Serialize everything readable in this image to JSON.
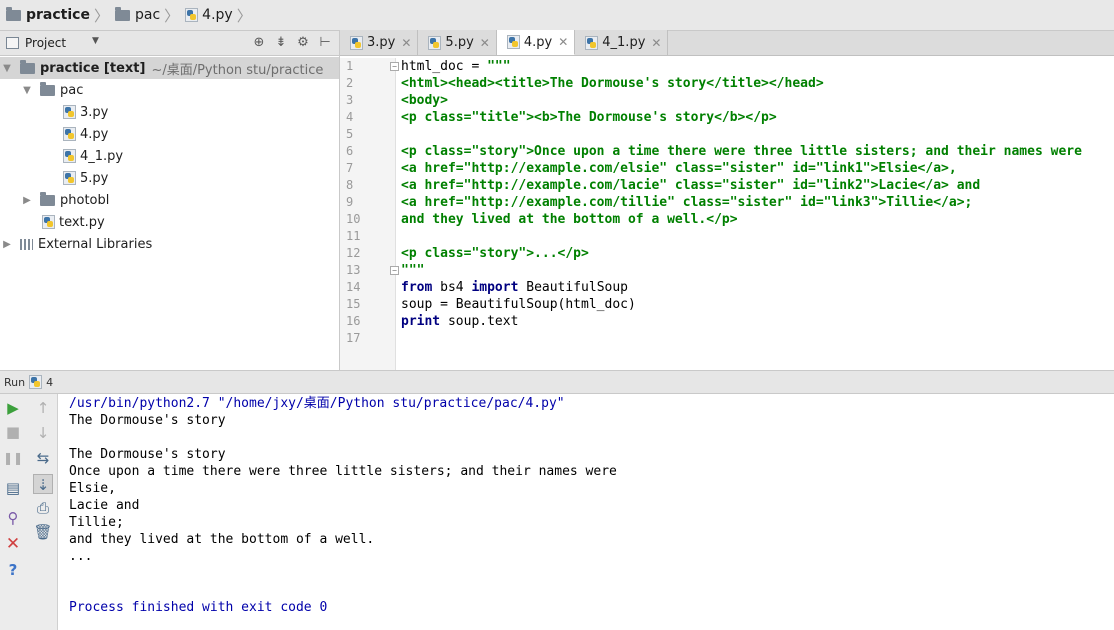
{
  "breadcrumb": {
    "root": "practice",
    "folder": "pac",
    "file": "4.py"
  },
  "project_panel": {
    "title": "Project",
    "tree": {
      "root_name": "practice [text]",
      "root_path": "~/桌面/Python stu/practice",
      "pac": "pac",
      "files": [
        "3.py",
        "4.py",
        "4_1.py",
        "5.py"
      ],
      "photobl": "photobl",
      "text_py": "text.py",
      "external": "External Libraries"
    }
  },
  "tabs": [
    "3.py",
    "5.py",
    "4.py",
    "4_1.py"
  ],
  "active_tab": "4.py",
  "editor": {
    "line_numbers": [
      "1",
      "2",
      "3",
      "4",
      "5",
      "6",
      "7",
      "8",
      "9",
      "10",
      "11",
      "12",
      "13",
      "14",
      "15",
      "16",
      "17"
    ],
    "lines": [
      "html_doc = \"\"\"",
      "<html><head><title>The Dormouse's story</title></head>",
      "<body>",
      "<p class=\"title\"><b>The Dormouse's story</b></p>",
      "",
      "<p class=\"story\">Once upon a time there were three little sisters; and their names were",
      "<a href=\"http://example.com/elsie\" class=\"sister\" id=\"link1\">Elsie</a>,",
      "<a href=\"http://example.com/lacie\" class=\"sister\" id=\"link2\">Lacie</a> and",
      "<a href=\"http://example.com/tillie\" class=\"sister\" id=\"link3\">Tillie</a>;",
      "and they lived at the bottom of a well.</p>",
      "",
      "<p class=\"story\">...</p>",
      "\"\"\"",
      "from bs4 import BeautifulSoup",
      "soup = BeautifulSoup(html_doc)",
      "print soup.text",
      ""
    ],
    "code_parts": {
      "var": "html_doc = ",
      "quote": "\"\"\"",
      "kw_from": "from",
      "mod": " bs4 ",
      "kw_import": "import",
      "cls": " BeautifulSoup",
      "kw_print": "print",
      "print_rest": " soup.text"
    }
  },
  "run": {
    "label": "Run",
    "config": "4",
    "command": "/usr/bin/python2.7 \"/home/jxy/桌面/Python stu/practice/pac/4.py\"",
    "output": [
      "The Dormouse's story",
      "",
      "The Dormouse's story",
      "Once upon a time there were three little sisters; and their names were",
      "Elsie,",
      "Lacie and",
      "Tillie;",
      "and they lived at the bottom of a well.",
      "...",
      "",
      ""
    ],
    "exit": "Process finished with exit code 0"
  },
  "colors": {
    "string": "#008000",
    "keyword": "#000080",
    "console_blue": "#0000aa",
    "run_green": "#3ca03c",
    "stop_red": "#d04040"
  },
  "icons": [
    "folder-icon",
    "python-file-icon",
    "project-icon",
    "locate-icon",
    "collapse-icon",
    "settings-icon",
    "hide-icon",
    "run-icon",
    "stop-icon",
    "pause-icon",
    "up-icon",
    "down-icon",
    "soft-wrap-icon",
    "scroll-end-icon",
    "print-icon",
    "trash-icon",
    "pin-icon",
    "close-icon",
    "help-icon"
  ]
}
